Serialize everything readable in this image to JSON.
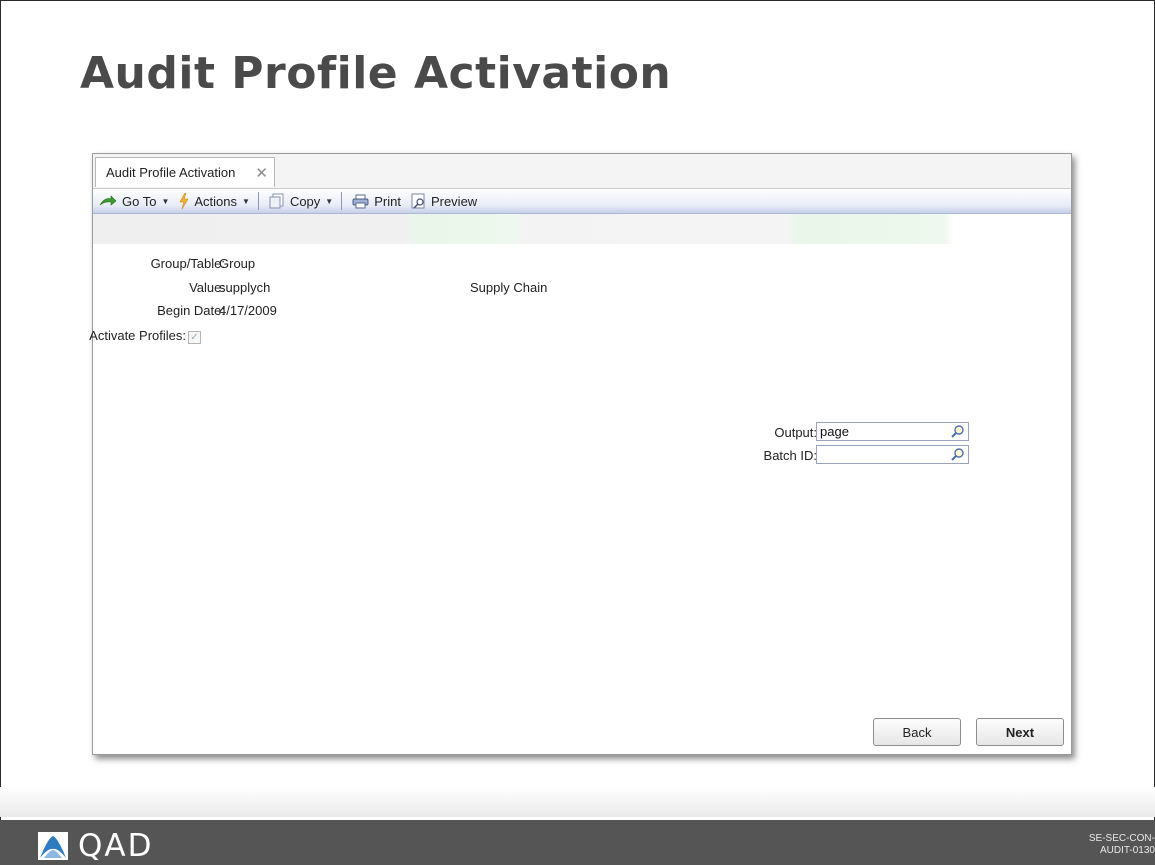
{
  "slide": {
    "title": "Audit Profile Activation",
    "code_line1": "SE-SEC-CON-",
    "code_line2": "AUDIT-0130",
    "brand": "QAD"
  },
  "window": {
    "tab_label": "Audit Profile Activation",
    "toolbar": {
      "goto_label": "Go To",
      "actions_label": "Actions",
      "copy_label": "Copy",
      "print_label": "Print",
      "preview_label": "Preview"
    }
  },
  "form": {
    "group_table_label": "Group/Table:",
    "group_table_value": "Group",
    "value_label": "Value:",
    "value_value": "supplych",
    "value_description": "Supply Chain",
    "begin_date_label": "Begin Date:",
    "begin_date_value": "4/17/2009",
    "activate_profiles_label": "Activate Profiles:",
    "activate_profiles_checked": true,
    "output_label": "Output:",
    "output_value": "page",
    "batch_id_label": "Batch ID:",
    "batch_id_value": ""
  },
  "buttons": {
    "back": "Back",
    "next": "Next"
  },
  "colors": {
    "footer_bg": "#555555",
    "title_text": "#4a4a4a",
    "toolbar_accent": "#c6cfe8"
  }
}
